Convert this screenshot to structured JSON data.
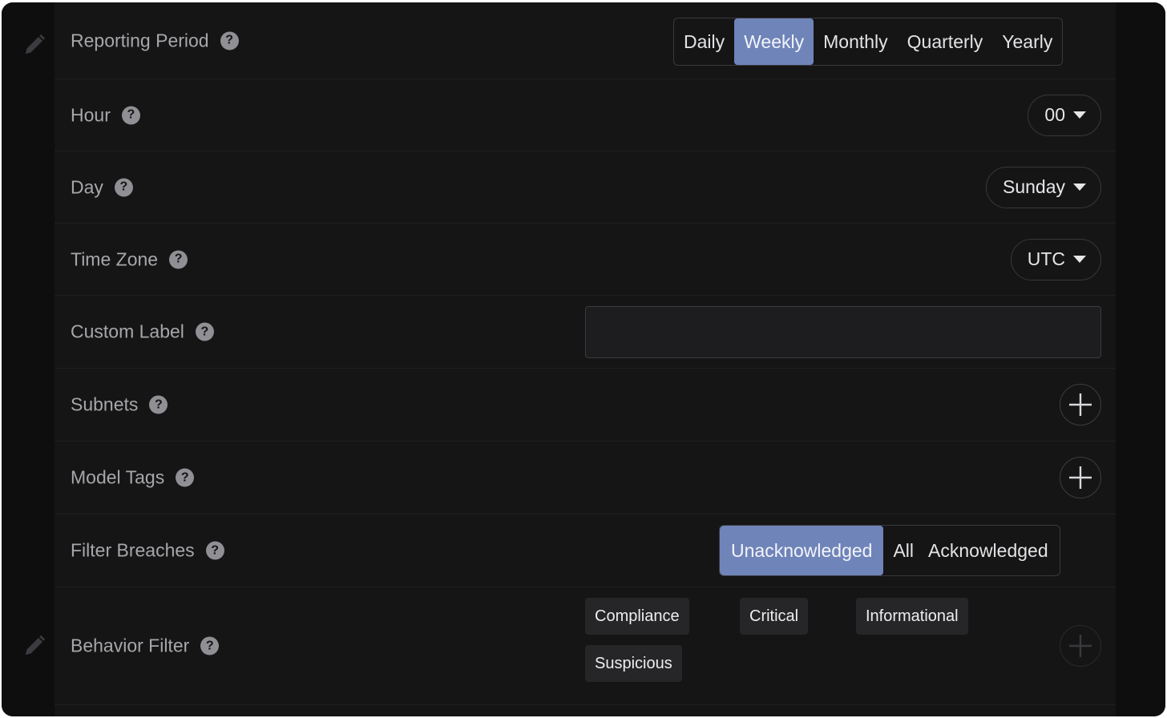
{
  "rows": {
    "reporting_period": {
      "label": "Reporting Period",
      "options": [
        "Daily",
        "Weekly",
        "Monthly",
        "Quarterly",
        "Yearly"
      ],
      "selected": "Weekly"
    },
    "hour": {
      "label": "Hour",
      "value": "00"
    },
    "day": {
      "label": "Day",
      "value": "Sunday"
    },
    "time_zone": {
      "label": "Time Zone",
      "value": "UTC"
    },
    "custom_label": {
      "label": "Custom Label",
      "value": "",
      "placeholder": ""
    },
    "subnets": {
      "label": "Subnets"
    },
    "model_tags": {
      "label": "Model Tags"
    },
    "filter_breaches": {
      "label": "Filter Breaches",
      "options": [
        "Unacknowledged",
        "All",
        "Acknowledged"
      ],
      "selected": "Unacknowledged"
    },
    "behavior_filter": {
      "label": "Behavior Filter",
      "tags": [
        "Compliance",
        "Critical",
        "Informational",
        "Suspicious"
      ]
    }
  },
  "help_glyph": "?",
  "colors": {
    "accent": "#6f84b8",
    "background": "#151516",
    "label_text": "#a7a7ab"
  },
  "icons": {
    "edit": "pencil-icon",
    "help": "help-icon",
    "add": "plus-icon",
    "dropdown": "caret-down-icon"
  }
}
